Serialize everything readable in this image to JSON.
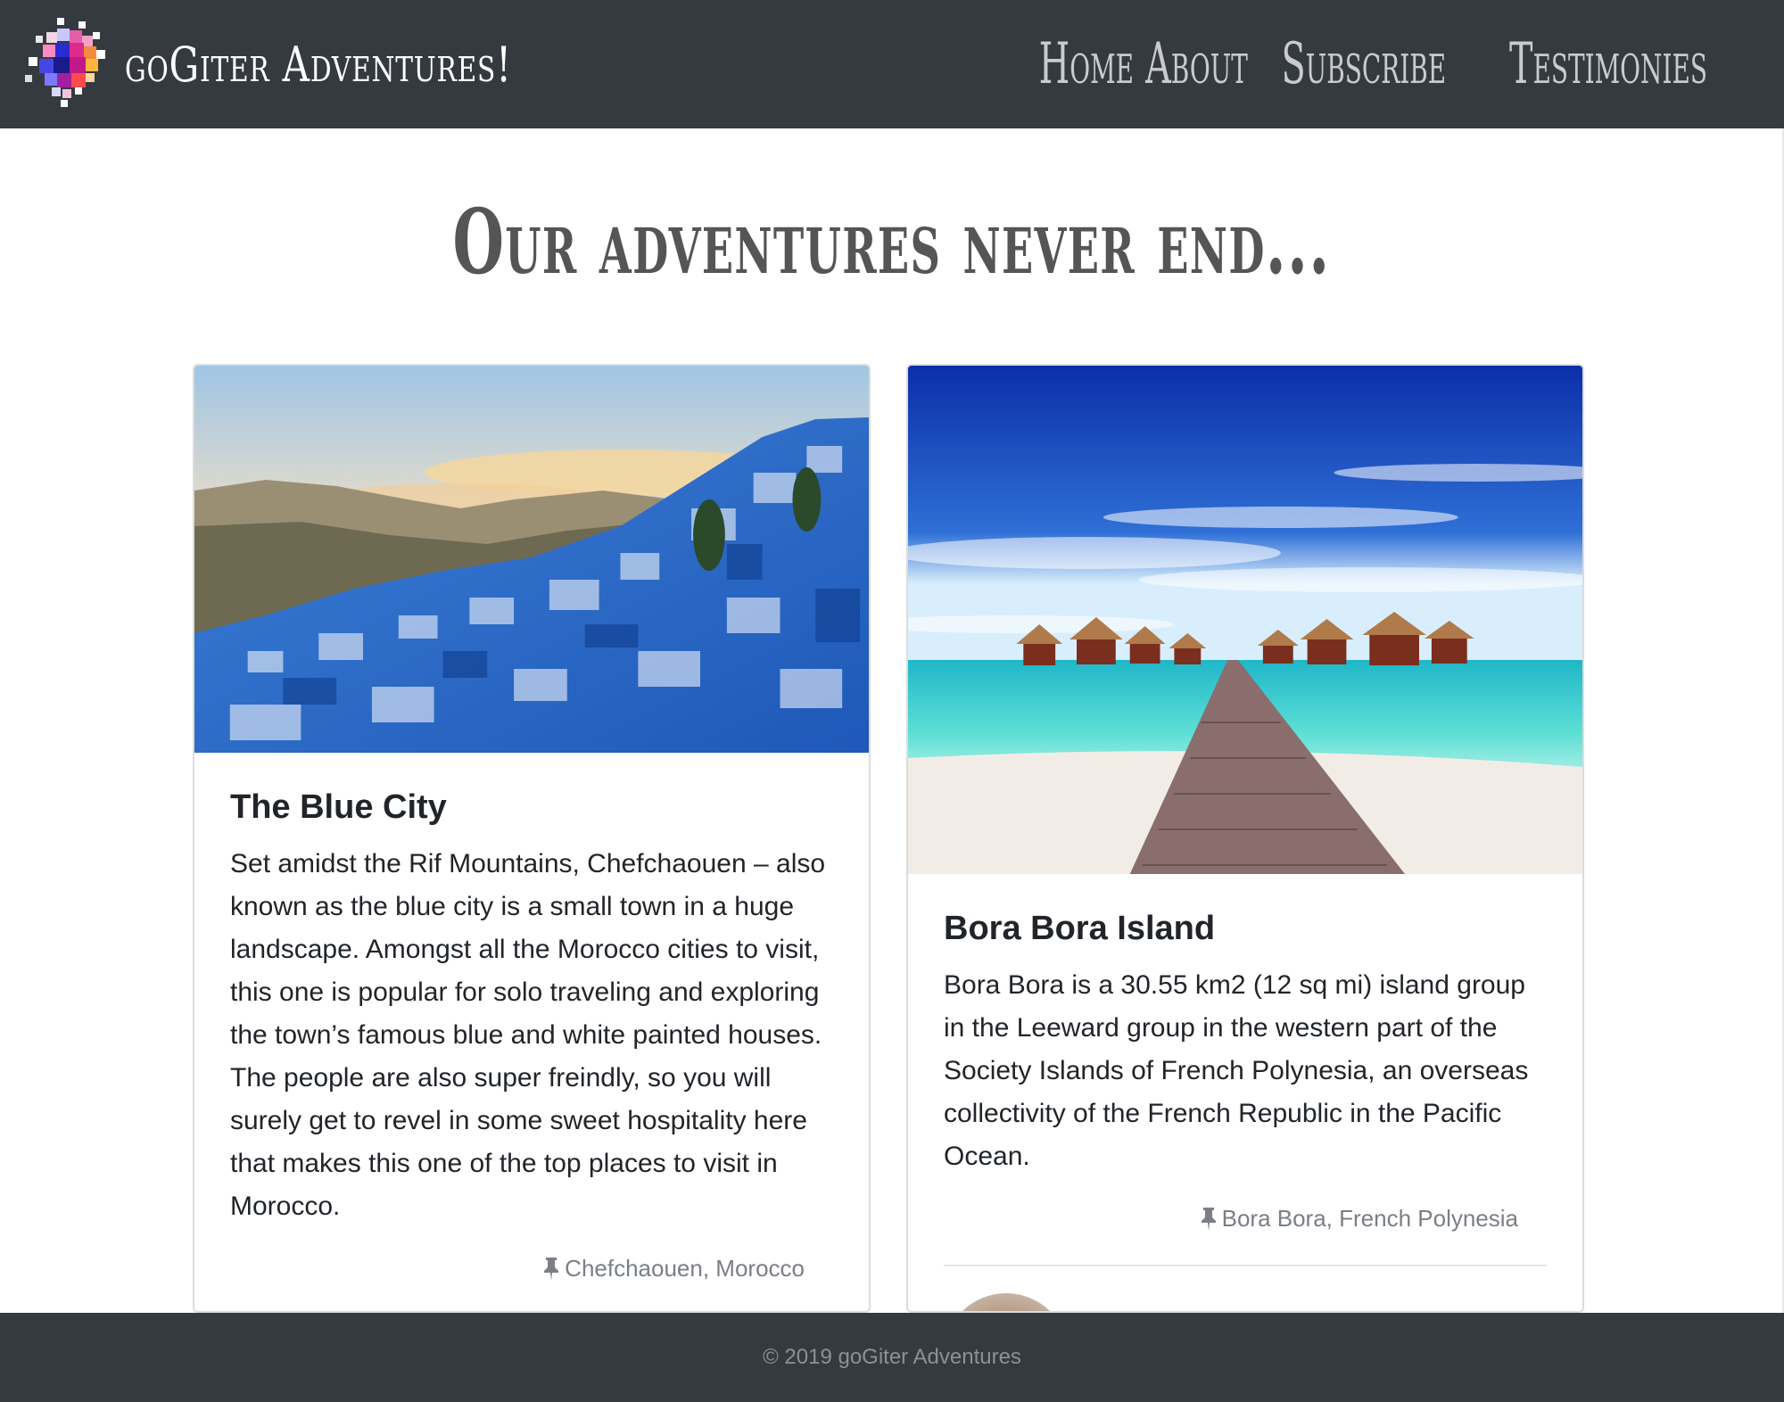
{
  "navbar": {
    "brand_text": "goGiter Adventures!",
    "links": [
      "Home",
      "About",
      "Subscribe",
      "Testimonies"
    ]
  },
  "hero": {
    "title": "Our adventures never end..."
  },
  "cards": [
    {
      "title": "The Blue City",
      "text": "Set amidst the Rif Mountains, Chefchaouen – also known as the blue city is a small town in a huge landscape. Amongst all the Morocco cities to visit, this one is popular for solo traveling and exploring the town’s famous blue and white painted houses. The people are also super freindly, so you will surely get to revel in some sweet hospitality here that makes this one of the top places to visit in Morocco.",
      "location": "Chefchaouen, Morocco"
    },
    {
      "title": "Bora Bora Island",
      "text": "Bora Bora is a 30.55 km2 (12 sq mi) island group in the Leeward group in the western part of the Society Islands of French Polynesia, an overseas collectivity of the French Republic in the Pacific Ocean.",
      "location": "Bora Bora, French Polynesia"
    }
  ],
  "footer": {
    "text": "© 2019 goGiter Adventures"
  },
  "colors": {
    "navbar_bg": "#343a40",
    "footer_bg": "#343a40",
    "muted_text": "#7a7f85"
  },
  "icons": {
    "logo": "pixel-logo-icon",
    "location": "pushpin-icon"
  }
}
